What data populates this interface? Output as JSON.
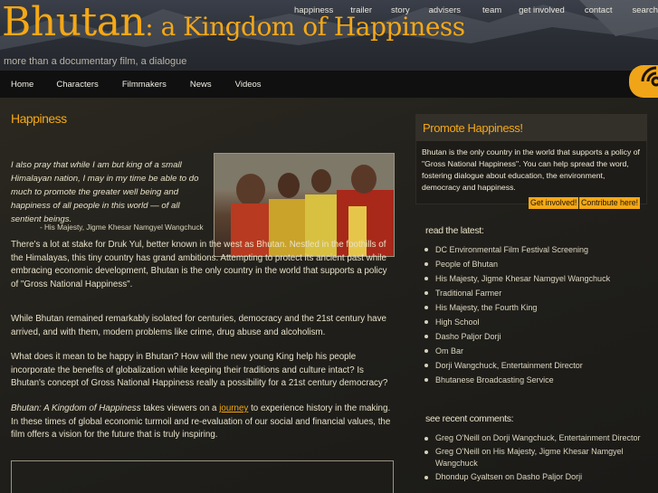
{
  "header": {
    "title_main": "Bhutan",
    "title_sub": ": a Kingdom of Happiness",
    "tagline": "more than a documentary film, a dialogue",
    "top_nav": [
      "happiness",
      "trailer",
      "story",
      "advisers",
      "team",
      "get involved",
      "contact",
      "search"
    ]
  },
  "main_nav": [
    "Home",
    "Characters",
    "Filmmakers",
    "News",
    "Videos"
  ],
  "article": {
    "title": "Happiness",
    "quote": "I also pray that while I am but king of a small Himalayan nation, I may in my time be able to do much to promote the greater well being and happiness of all people in this world — of all sentient beings.",
    "attribution": "- His Majesty, Jigme Khesar Namgyel Wangchuck",
    "p1": "There's a lot at stake for Druk Yul, better known in the west as Bhutan. Nestled in the foothills of the Himalayas, this tiny country has grand ambitions. Attempting to protect its ancient past while embracing economic development, Bhutan is the only country in the world that supports a policy of \"Gross National Happiness\".",
    "p2": "While Bhutan remained remarkably isolated for centuries, democracy and the 21st century have arrived, and with them, modern problems like crime, drug abuse and alcoholism.",
    "p3": "What does it mean to be happy in Bhutan? How will the new young King help his people incorporate the benefits of globalization while keeping their traditions and culture intact? Is Bhutan's concept of Gross National Happiness really a possibility for a 21st century democracy?",
    "p4_em": "Bhutan: A Kingdom of Happiness",
    "p4_a": " takes viewers on a ",
    "p4_link": "journey",
    "p4_b": " to experience history in the making. In these times of global economic turmoil and re-evaluation of our social and financial values, the film offers a vision for the future that is truly inspiring."
  },
  "promo": {
    "title": "Promote Happiness!",
    "text": "Bhutan is the only country in the world that supports a policy of \"Gross National Happiness\". You can help spread the word, fostering dialogue about education, the environment, democracy and happiness.",
    "btn_involved": "Get involved!",
    "btn_contribute": "Contribute here!"
  },
  "latest": {
    "heading": "read the latest:",
    "items": [
      "DC Environmental Film Festival Screening",
      "People of Bhutan",
      "His Majesty, Jigme Khesar Namgyel Wangchuck",
      "Traditional Farmer",
      "His Majesty, the Fourth King",
      "High School",
      "Dasho Paljor Dorji",
      "Om Bar",
      "Dorji Wangchuck, Entertainment Director",
      "Bhutanese Broadcasting Service"
    ]
  },
  "comments": {
    "heading": "see recent comments:",
    "items": [
      {
        "author": "Greg O'Neill",
        "on": " on ",
        "post": "Dorji Wangchuck, Entertainment Director"
      },
      {
        "author": "Greg O'Neill",
        "on": " on ",
        "post": "His Majesty, Jigme Khesar Namgyel Wangchuck"
      },
      {
        "author": "Dhondup Gyaltsen",
        "on": " on ",
        "post": "Dasho Paljor Dorji"
      }
    ]
  },
  "icons": {
    "feed": "rss-feed-icon"
  },
  "colors": {
    "accent": "#f5a815",
    "background": "#1c1b18",
    "navbar": "#101010"
  }
}
